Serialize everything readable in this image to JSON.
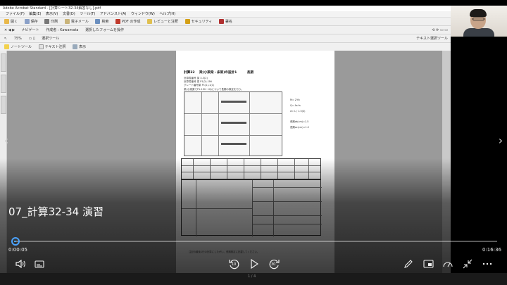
{
  "acrobat": {
    "title": "Adobe Acrobat Standard - [計算シート32-34解答なし].pdf",
    "menu": [
      "ファイル(F)",
      "編集(E)",
      "表示(V)",
      "文書(D)",
      "ツール(T)",
      "アドバンスト(A)",
      "ウィンドウ(W)",
      "ヘルプ(H)"
    ],
    "toolbar1": [
      "開く",
      "保存",
      "印刷",
      "電子メール",
      "検索",
      "PDF の作成",
      "レビューと注釈",
      "セキュリティ",
      "署名"
    ],
    "toolbar2_left": "ナビゲート",
    "toolbar2_mid": "作成者 : Kawamata",
    "toolbar2_mid2": "選択したフォームを操作",
    "toolbar3_zoom": "75%",
    "toolbar3_select": "選択ツール",
    "toolbar3_right": "テキスト選択ツール",
    "toolbar4": [
      "ノートツール",
      "テキスト注釈",
      "表示"
    ],
    "page_indicator": "1 / 4"
  },
  "document": {
    "heading_num": "計算32",
    "heading_title": "梁(小梁梁・床梁)の設計1",
    "heading_right": "長期",
    "lines": [
      "計算書番号 梁  3-3(2)",
      "計算書番号 梁  P1(2)-1Mi",
      "グレード番号梁  P1(1)-1(1)",
      "梁(小梁梁でP1-1Mi~10)について長期の検定を行う。"
    ],
    "formulas": [
      "M=  Z·fb",
      "Q=   As·fs",
      "σ=   L / 1.5(4)",
      "長期σt(cm)=1.5",
      "長期σc(cm)=1.5"
    ],
    "footer_note": "注記の最後1行の計算にしたがい、長期検定に記載してください。"
  },
  "video": {
    "title": "07_計算32-34 演習",
    "current_time": "0:00:05",
    "duration": "0:16:36",
    "progress": 0.005,
    "skip_back": "10",
    "skip_forward": "30",
    "accent": "#4aa3ff"
  },
  "icons": {
    "volume": "volume-icon",
    "captions": "captions-icon",
    "play": "play-icon",
    "pen": "pen-icon",
    "minimize": "mini-player-icon",
    "speed": "playback-speed-icon",
    "collapse": "collapse-icon",
    "more": "more-icon"
  }
}
